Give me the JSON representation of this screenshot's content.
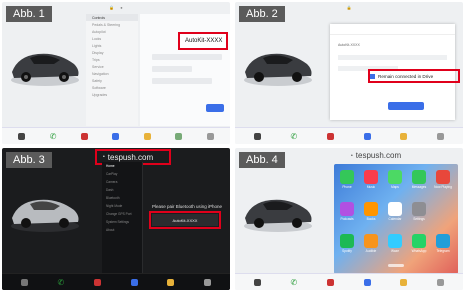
{
  "panels": [
    {
      "badge": "Abb. 1"
    },
    {
      "badge": "Abb. 2"
    },
    {
      "badge": "Abb. 3"
    },
    {
      "badge": "Abb. 4"
    }
  ],
  "p1": {
    "device_chip": "AutoKit-XXXX",
    "menu_items": [
      "Controls",
      "Pedals & Steering",
      "Autopilot",
      "Locks",
      "Lights",
      "Display",
      "Trips",
      "Service",
      "Navigation",
      "Safety",
      "Software",
      "Upgrades"
    ]
  },
  "p2": {
    "device_name": "AutoKit-XXXX",
    "checkbox_label": "Remain connected in Drive"
  },
  "p3": {
    "url": "tespush.com",
    "prompt": "Please pair Bluetooth using iPhone",
    "device_button": "AutoKit-XXXX",
    "sidebar_items": [
      "Home",
      "CarPlay",
      "Camera",
      "Dash",
      "Bluetooth",
      "Night Mode",
      "Change GPS Port",
      "System Settings",
      "About"
    ]
  },
  "p4": {
    "url": "tespush.com",
    "apps": [
      {
        "label": "Phone",
        "color": "#34c759"
      },
      {
        "label": "Music",
        "color": "#fa3c4c"
      },
      {
        "label": "Maps",
        "color": "#4cd964"
      },
      {
        "label": "Messages",
        "color": "#34c759"
      },
      {
        "label": "Now Playing",
        "color": "#e8473b"
      },
      {
        "label": "Podcasts",
        "color": "#b150e2"
      },
      {
        "label": "Books",
        "color": "#ff9500"
      },
      {
        "label": "Calendar",
        "color": "#ffffff"
      },
      {
        "label": "Settings",
        "color": "#8e8e93"
      },
      {
        "label": "Spotify",
        "color": "#1db954"
      },
      {
        "label": "Audible",
        "color": "#f7941d"
      },
      {
        "label": "Waze",
        "color": "#33ccff"
      },
      {
        "label": "WhatsApp",
        "color": "#25d366"
      },
      {
        "label": "Telegram",
        "color": "#229ed9"
      }
    ]
  },
  "colors": {
    "highlight": "#e0001b",
    "accent": "#3a6ee8"
  }
}
